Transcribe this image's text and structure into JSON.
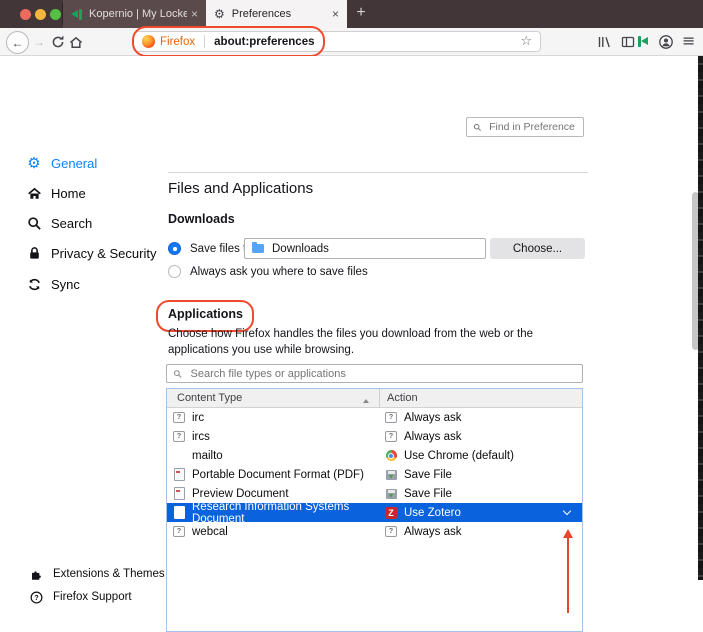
{
  "colors": {
    "accent_blue": "#0a84ff",
    "selected_row_blue": "#0a62dc",
    "annotation_red": "#ee4b2e",
    "tabbar_bg": "#433638",
    "brand_orange": "#e0670f",
    "traffic_lights": [
      "#ee6a5e",
      "#f5b63e",
      "#53c043"
    ]
  },
  "tabbar": {
    "tabs": [
      {
        "label": "Kopernio | My Locker",
        "icon": "kopernio-icon",
        "active": false
      },
      {
        "label": "Preferences",
        "icon": "gear-icon",
        "active": true
      }
    ],
    "close_glyph": "×",
    "new_tab_glyph": "+"
  },
  "toolbar": {
    "back_glyph": "←",
    "forward_glyph": "→",
    "url_brand": "Firefox",
    "url_value": "about:preferences",
    "star_glyph": "☆",
    "menu_glyph": "≡"
  },
  "find_in_preferences": {
    "placeholder": "Find in Preferences"
  },
  "sidebar": {
    "items": [
      {
        "label": "General",
        "icon": "gear-icon",
        "active": true
      },
      {
        "label": "Home",
        "icon": "home-icon",
        "active": false
      },
      {
        "label": "Search",
        "icon": "search-icon",
        "active": false
      },
      {
        "label": "Privacy & Security",
        "icon": "lock-icon",
        "active": false
      },
      {
        "label": "Sync",
        "icon": "sync-icon",
        "active": false
      }
    ],
    "footer_items": [
      {
        "label": "Extensions & Themes",
        "icon": "puzzle-icon"
      },
      {
        "label": "Firefox Support",
        "icon": "question-circle-icon"
      }
    ]
  },
  "main": {
    "title": "Files and Applications",
    "downloads": {
      "heading": "Downloads",
      "save_files_to_label": "Save files to",
      "save_files_to_selected": true,
      "download_folder": "Downloads",
      "choose_button": "Choose...",
      "always_ask_label": "Always ask you where to save files",
      "always_ask_selected": false
    },
    "applications": {
      "heading": "Applications",
      "description": "Choose how Firefox handles the files you download from the web or the applications you use while browsing.",
      "search_placeholder": "Search file types or applications",
      "table": {
        "columns": [
          "Content Type",
          "Action"
        ],
        "sort": {
          "column": "Content Type",
          "direction": "ascending"
        },
        "rows": [
          {
            "content_type": "irc",
            "type_icon": "question-bubble-icon",
            "action": "Always ask",
            "action_icon": "question-bubble-icon",
            "selected": false
          },
          {
            "content_type": "ircs",
            "type_icon": "question-bubble-icon",
            "action": "Always ask",
            "action_icon": "question-bubble-icon",
            "selected": false
          },
          {
            "content_type": "mailto",
            "type_icon": "",
            "action": "Use Chrome (default)",
            "action_icon": "chrome-icon",
            "selected": false
          },
          {
            "content_type": "Portable Document Format (PDF)",
            "type_icon": "document-icon",
            "action": "Save File",
            "action_icon": "save-file-icon",
            "selected": false
          },
          {
            "content_type": "Preview Document",
            "type_icon": "document-icon",
            "action": "Save File",
            "action_icon": "save-file-icon",
            "selected": false
          },
          {
            "content_type": "Research Information Systems Document",
            "type_icon": "document-icon",
            "action": "Use Zotero",
            "action_icon": "zotero-icon",
            "selected": true
          },
          {
            "content_type": "webcal",
            "type_icon": "question-bubble-icon",
            "action": "Always ask",
            "action_icon": "question-bubble-icon",
            "selected": false
          }
        ]
      }
    }
  }
}
